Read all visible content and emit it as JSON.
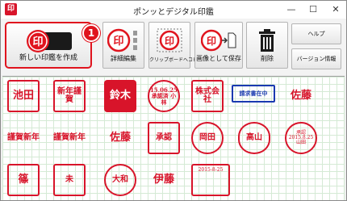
{
  "window": {
    "title": "ポンッとデジタル印鑑",
    "app_icon_glyph": "印",
    "controls": {
      "minimize": "—",
      "maximize": "☐",
      "close": "✕"
    }
  },
  "toolbar": {
    "new_stamp_label": "新しい印鑑を作成",
    "detail_edit_label": "詳細編集",
    "clipboard_copy_label": "クリップボードへコピー",
    "save_image_label": "画像として保存",
    "delete_label": "削除",
    "help_label": "ヘルプ",
    "version_label": "バージョン情報",
    "callout_number": "1",
    "icon_glyph": "印"
  },
  "gallery": {
    "row1": [
      "池田",
      "新年謹賀",
      "鈴木",
      "15.06.25 承認済 小林",
      "株式会社",
      "請求書在中",
      "佐藤"
    ],
    "row2": [
      "謹賀新年",
      "謹賀新年",
      "佐藤",
      "承認",
      "岡田",
      "高山",
      "承認 2015.8.25 山田"
    ],
    "row3": [
      "篠",
      "未",
      "大和",
      "伊藤",
      "2015-8-25",
      "",
      ""
    ]
  },
  "colors": {
    "stamp_red": "#d8142a",
    "accent_red": "#e0141e",
    "stamp_blue": "#1a3ab0"
  }
}
